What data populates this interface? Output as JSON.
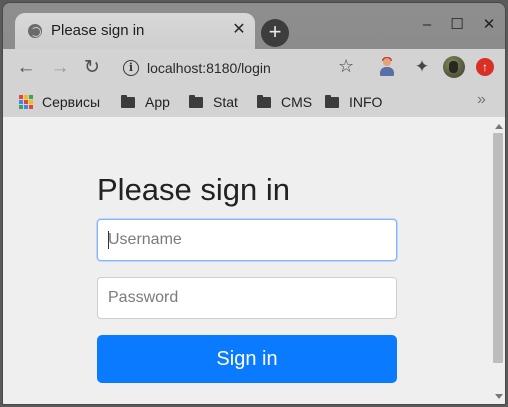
{
  "browser": {
    "tab": {
      "title": "Please sign in",
      "favicon": "globe-icon",
      "close": "✕"
    },
    "new_tab": "+",
    "window_controls": {
      "minimize": "–",
      "maximize": "☐",
      "close": "✕"
    },
    "nav": {
      "back": "←",
      "forward": "→",
      "reload": "↻"
    },
    "address": {
      "url": "localhost:8180/login",
      "info": "i"
    },
    "bookmarks": [
      {
        "label": "Сервисы",
        "icon": "apps-grid-icon"
      },
      {
        "label": "App",
        "icon": "folder-icon"
      },
      {
        "label": "Stat",
        "icon": "folder-icon"
      },
      {
        "label": "CMS",
        "icon": "folder-icon"
      },
      {
        "label": "INFO",
        "icon": "folder-icon"
      }
    ],
    "bookmarks_overflow": "»"
  },
  "login": {
    "heading": "Please sign in",
    "username_placeholder": "Username",
    "password_placeholder": "Password",
    "submit_label": "Sign in"
  },
  "colors": {
    "accent": "#0a7bff",
    "focus_border": "#86b7fe",
    "page_background": "#efefef"
  }
}
